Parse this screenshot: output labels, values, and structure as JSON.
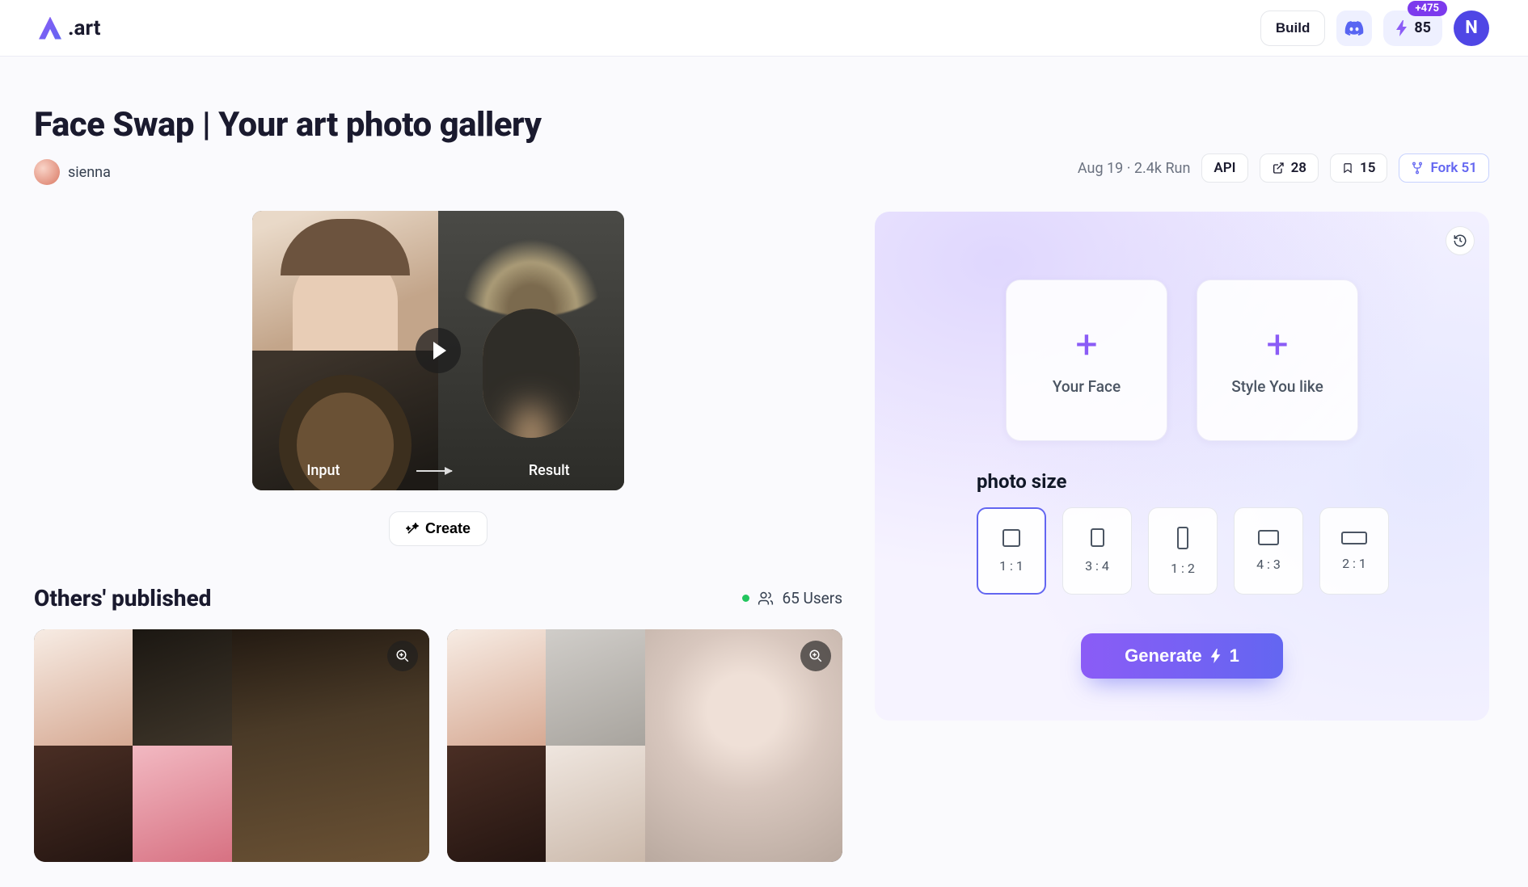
{
  "header": {
    "brand": ".art",
    "build_label": "Build",
    "credits": "85",
    "credits_bonus": "+475",
    "avatar_initial": "N"
  },
  "page": {
    "title": "Face Swap | Your art photo gallery",
    "author": "sienna",
    "meta_text": "Aug 19 · 2.4k Run",
    "api_label": "API",
    "share_count": "28",
    "bookmark_count": "15",
    "fork_label": "Fork 51"
  },
  "hero": {
    "input_label": "Input",
    "result_label": "Result",
    "create_label": "Create"
  },
  "others": {
    "title": "Others' published",
    "users": "65 Users"
  },
  "panel": {
    "upload_face_label": "Your Face",
    "upload_style_label": "Style You like",
    "size_title": "photo size",
    "sizes": [
      "1 : 1",
      "3 : 4",
      "1 : 2",
      "4 : 3",
      "2 : 1"
    ],
    "generate_label": "Generate",
    "generate_cost": "1"
  }
}
